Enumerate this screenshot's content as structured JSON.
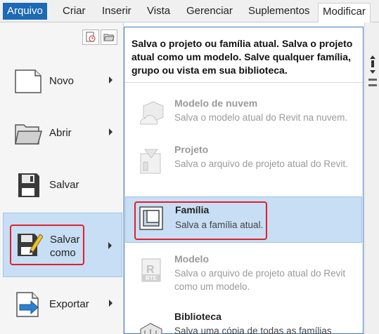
{
  "menubar": {
    "tabs": [
      {
        "label": "Arquivo"
      },
      {
        "label": "Criar"
      },
      {
        "label": "Inserir"
      },
      {
        "label": "Vista"
      },
      {
        "label": "Gerenciar"
      },
      {
        "label": "Suplementos"
      },
      {
        "label": "Modificar"
      }
    ]
  },
  "left_menu": {
    "items": [
      {
        "label": "Novo",
        "icon": "new-document-icon"
      },
      {
        "label": "Abrir",
        "icon": "folder-open-icon"
      },
      {
        "label": "Salvar",
        "icon": "floppy-disk-icon"
      },
      {
        "label": "Salvar como",
        "label_line1": "Salvar",
        "label_line2": "como",
        "icon": "save-as-icon"
      },
      {
        "label": "Exportar",
        "icon": "export-icon"
      }
    ]
  },
  "panel": {
    "description": "Salva o projeto ou família atual. Salva o projeto atual como um modelo. Salve qualquer família, grupo ou vista em sua biblioteca.",
    "options": [
      {
        "title": "Modelo de nuvem",
        "desc": "Salva o modelo atual do Revit na nuvem.",
        "icon": "cloud-model-icon",
        "state": "disabled"
      },
      {
        "title": "Projeto",
        "desc": "Salva o arquivo de projeto atual do Revit.",
        "icon": "project-icon",
        "state": "disabled"
      },
      {
        "title": "Família",
        "desc": "Salva a família atual.",
        "icon": "family-icon",
        "state": "selected"
      },
      {
        "title": "Modelo",
        "desc": "Salva o arquivo de projeto atual do Revit como um modelo.",
        "icon": "template-rte-icon",
        "state": "disabled"
      },
      {
        "title": "Biblioteca",
        "desc": "Salva uma cópia de todas as famílias",
        "icon": "library-icon",
        "state": "normal"
      }
    ]
  },
  "colors": {
    "accent": "#1c69b6",
    "highlight": "#c7def4",
    "annotation": "#e0202a"
  }
}
